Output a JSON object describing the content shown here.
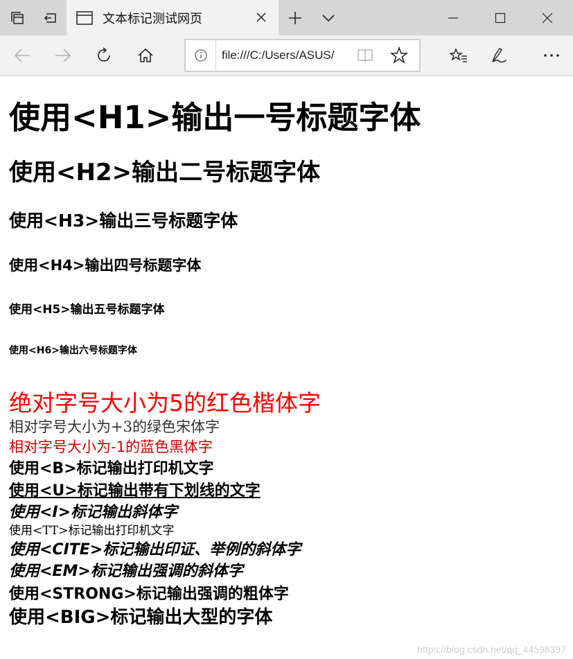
{
  "browser": {
    "tab_title": "文本标记测试网页",
    "url": "file:///C:/Users/ASUS/"
  },
  "content": {
    "h1": "使用<H1>输出一号标题字体",
    "h2": "使用<H2>输出二号标题字体",
    "h3": "使用<H3>输出三号标题字体",
    "h4": "使用<H4>输出四号标题字体",
    "h5": "使用<H5>输出五号标题字体",
    "h6": "使用<H6>输出六号标题字体",
    "red_kai": "绝对字号大小为5的红色楷体字",
    "green_song": "相对字号大小为+3的绿色宋体字",
    "blue_hei": "相对字号大小为-1的蓝色黑体字",
    "b": "使用<B>标记输出打印机文字",
    "u": "使用<U>标记输出带有下划线的文字",
    "i": "使用<I>标记输出斜体字",
    "tt": "使用<TT>标记输出打印机文字",
    "cite": "使用<CITE>标记输出印证、举例的斜体字",
    "em": "使用<EM>标记输出强调的斜体字",
    "strong": "使用<STRONG>标记输出强调的粗体字",
    "big": "使用<BIG>标记输出大型的字体"
  },
  "watermark": "https://blog.csdn.net/qq_44598397",
  "colors": {
    "red": "#ff0000",
    "dark_red": "#cc0000",
    "tabbar": "#d6d6d6",
    "toolbar": "#f2f2f2"
  },
  "icons": [
    "tabs-aside-icon",
    "tab-back-icon",
    "page-icon",
    "close-icon",
    "plus-icon",
    "chevron-down-icon",
    "minimize-icon",
    "maximize-icon",
    "window-close-icon",
    "back-arrow-icon",
    "forward-arrow-icon",
    "refresh-icon",
    "home-icon",
    "info-icon",
    "reading-view-icon",
    "favorite-star-icon",
    "favorites-list-icon",
    "pen-icon",
    "more-icon"
  ]
}
